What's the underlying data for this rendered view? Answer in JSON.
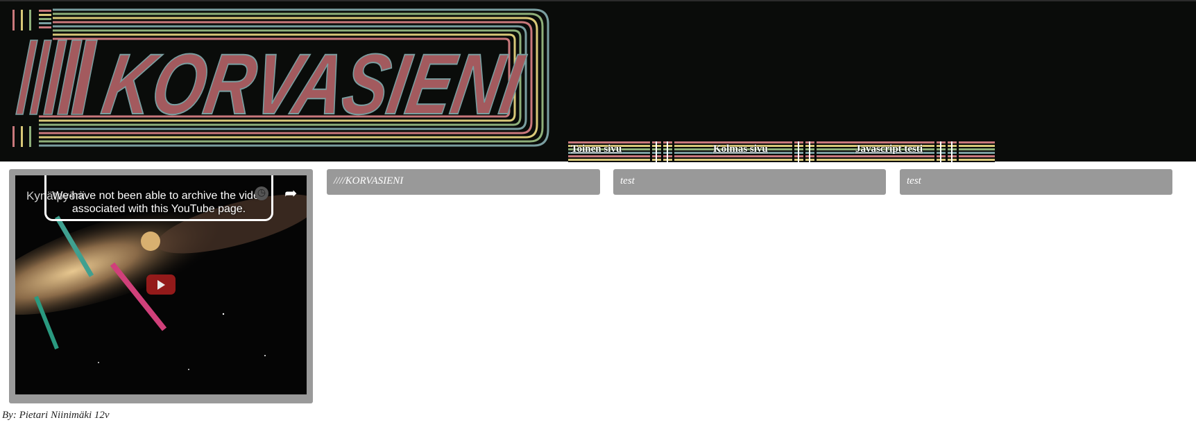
{
  "logo": {
    "text": "////KORVASIENI"
  },
  "nav": {
    "items": [
      {
        "label": "Toinen sivu"
      },
      {
        "label": "Kolmas sivu"
      },
      {
        "label": "Javascript testi"
      }
    ]
  },
  "video": {
    "title": "Kynätpyörii",
    "archive_notice": "We have not been able to archive the video associated with this YouTube page.",
    "icons": {
      "clock": "clock-icon",
      "share": "share-icon",
      "play": "play-icon"
    }
  },
  "boxes": [
    {
      "label": "////KORVASIENI"
    },
    {
      "label": "test"
    },
    {
      "label": "test"
    }
  ],
  "footer": {
    "credit": "By: Pietari Niinimäki 12v"
  },
  "colors": {
    "header_bg": "#0a0c0a",
    "logo_fill": "#a35a5e",
    "stripe_red": "#c9787c",
    "stripe_yellow": "#d8c878",
    "stripe_green": "#8fb07a",
    "stripe_teal": "#7a9ea0",
    "box_gray": "#999999"
  }
}
